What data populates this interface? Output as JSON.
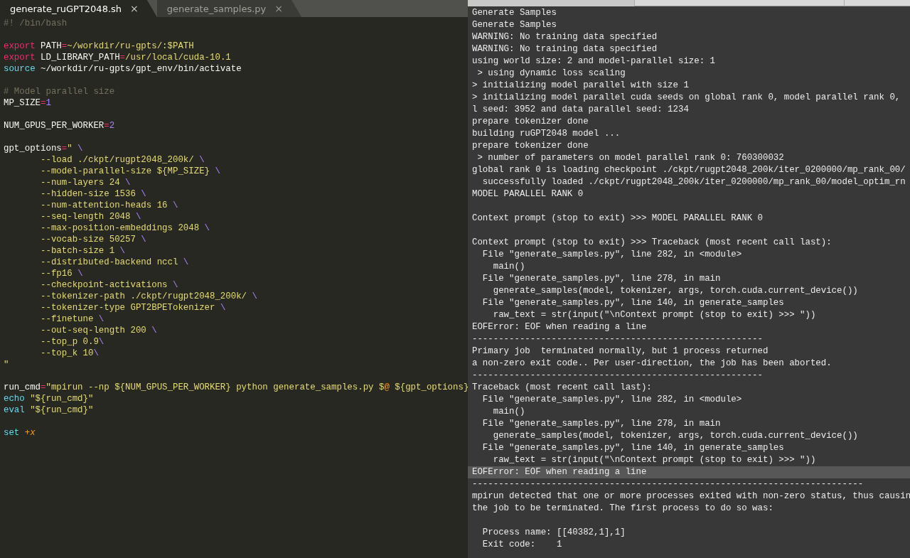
{
  "editor": {
    "tabs": [
      {
        "label": "generate_ruGPT2048.sh",
        "close": "×",
        "selected": true
      },
      {
        "label": "generate_samples.py",
        "close": "×",
        "selected": false
      }
    ],
    "lines": [
      {
        "kind": "code",
        "tokens": [
          {
            "text": "#! /bin/bash",
            "kind": "comment"
          }
        ]
      },
      {
        "kind": "blank"
      },
      {
        "kind": "code",
        "tokens": [
          {
            "text": "export",
            "kind": "keyword"
          },
          {
            "text": " PATH",
            "kind": "plain"
          },
          {
            "text": "=",
            "kind": "operator"
          },
          {
            "text": "~/workdir/ru-gpts/:$PATH",
            "kind": "string"
          }
        ]
      },
      {
        "kind": "code",
        "tokens": [
          {
            "text": "export",
            "kind": "keyword"
          },
          {
            "text": " LD_LIBRARY_PATH",
            "kind": "plain"
          },
          {
            "text": "=",
            "kind": "operator"
          },
          {
            "text": "/usr/local/cuda-10.1",
            "kind": "string"
          }
        ]
      },
      {
        "kind": "code",
        "tokens": [
          {
            "text": "source",
            "kind": "builtin"
          },
          {
            "text": " ~/workdir/ru-gpts/gpt_env/bin/activate",
            "kind": "plain"
          }
        ]
      },
      {
        "kind": "blank"
      },
      {
        "kind": "code",
        "tokens": [
          {
            "text": "# Model parallel size",
            "kind": "comment"
          }
        ]
      },
      {
        "kind": "code",
        "tokens": [
          {
            "text": "MP_SIZE",
            "kind": "plain"
          },
          {
            "text": "=",
            "kind": "operator"
          },
          {
            "text": "1",
            "kind": "number"
          }
        ]
      },
      {
        "kind": "blank"
      },
      {
        "kind": "code",
        "tokens": [
          {
            "text": "NUM_GPUS_PER_WORKER",
            "kind": "plain"
          },
          {
            "text": "=",
            "kind": "operator"
          },
          {
            "text": "2",
            "kind": "number"
          }
        ]
      },
      {
        "kind": "blank"
      },
      {
        "kind": "code",
        "tokens": [
          {
            "text": "gpt_options",
            "kind": "plain"
          },
          {
            "text": "=",
            "kind": "operator"
          },
          {
            "text": "\" ",
            "kind": "string"
          },
          {
            "text": "\\",
            "kind": "escape"
          }
        ]
      },
      {
        "kind": "code",
        "tokens": [
          {
            "text": "\t--load ./ckpt/rugpt2048_200k/ ",
            "kind": "string"
          },
          {
            "text": "\\",
            "kind": "escape"
          }
        ]
      },
      {
        "kind": "code",
        "tokens": [
          {
            "text": "\t--model-parallel-size ${MP_SIZE} ",
            "kind": "string"
          },
          {
            "text": "\\",
            "kind": "escape"
          }
        ]
      },
      {
        "kind": "code",
        "tokens": [
          {
            "text": "\t--num-layers 24 ",
            "kind": "string"
          },
          {
            "text": "\\",
            "kind": "escape"
          }
        ]
      },
      {
        "kind": "code",
        "tokens": [
          {
            "text": "\t--hidden-size 1536 ",
            "kind": "string"
          },
          {
            "text": "\\",
            "kind": "escape"
          }
        ]
      },
      {
        "kind": "code",
        "tokens": [
          {
            "text": "\t--num-attention-heads 16 ",
            "kind": "string"
          },
          {
            "text": "\\",
            "kind": "escape"
          }
        ]
      },
      {
        "kind": "code",
        "tokens": [
          {
            "text": "\t--seq-length 2048 ",
            "kind": "string"
          },
          {
            "text": "\\",
            "kind": "escape"
          }
        ]
      },
      {
        "kind": "code",
        "tokens": [
          {
            "text": "\t--max-position-embeddings 2048 ",
            "kind": "string"
          },
          {
            "text": "\\",
            "kind": "escape"
          }
        ]
      },
      {
        "kind": "code",
        "tokens": [
          {
            "text": "\t--vocab-size 50257 ",
            "kind": "string"
          },
          {
            "text": "\\",
            "kind": "escape"
          }
        ]
      },
      {
        "kind": "code",
        "tokens": [
          {
            "text": "\t--batch-size 1 ",
            "kind": "string"
          },
          {
            "text": "\\",
            "kind": "escape"
          }
        ]
      },
      {
        "kind": "code",
        "tokens": [
          {
            "text": "\t--distributed-backend nccl ",
            "kind": "string"
          },
          {
            "text": "\\",
            "kind": "escape"
          }
        ]
      },
      {
        "kind": "code",
        "tokens": [
          {
            "text": "\t--fp16 ",
            "kind": "string"
          },
          {
            "text": "\\",
            "kind": "escape"
          }
        ]
      },
      {
        "kind": "code",
        "tokens": [
          {
            "text": "\t--checkpoint-activations ",
            "kind": "string"
          },
          {
            "text": "\\",
            "kind": "escape"
          }
        ]
      },
      {
        "kind": "code",
        "tokens": [
          {
            "text": "\t--tokenizer-path ./ckpt/rugpt2048_200k/ ",
            "kind": "string"
          },
          {
            "text": "\\",
            "kind": "escape"
          }
        ]
      },
      {
        "kind": "code",
        "tokens": [
          {
            "text": "\t--tokenizer-type GPT2BPETokenizer ",
            "kind": "string"
          },
          {
            "text": "\\",
            "kind": "escape"
          }
        ]
      },
      {
        "kind": "code",
        "tokens": [
          {
            "text": "\t--finetune ",
            "kind": "string"
          },
          {
            "text": "\\",
            "kind": "escape"
          }
        ]
      },
      {
        "kind": "code",
        "tokens": [
          {
            "text": "\t--out-seq-length 200 ",
            "kind": "string"
          },
          {
            "text": "\\",
            "kind": "escape"
          }
        ]
      },
      {
        "kind": "code",
        "tokens": [
          {
            "text": "\t--top_p 0.9",
            "kind": "string"
          },
          {
            "text": "\\",
            "kind": "escape"
          }
        ]
      },
      {
        "kind": "code",
        "tokens": [
          {
            "text": "\t--top_k 10",
            "kind": "string"
          },
          {
            "text": "\\",
            "kind": "escape"
          }
        ]
      },
      {
        "kind": "code",
        "tokens": [
          {
            "text": "\"",
            "kind": "string"
          }
        ]
      },
      {
        "kind": "blank"
      },
      {
        "kind": "code",
        "tokens": [
          {
            "text": "run_cmd",
            "kind": "plain"
          },
          {
            "text": "=",
            "kind": "operator"
          },
          {
            "text": "\"mpirun --np ${NUM_GPUS_PER_WORKER} python generate_samples.py $",
            "kind": "string"
          },
          {
            "text": "@",
            "kind": "special"
          },
          {
            "text": " ${gpt_options}",
            "kind": "string"
          }
        ]
      },
      {
        "kind": "code",
        "tokens": [
          {
            "text": "echo",
            "kind": "builtin"
          },
          {
            "text": " \"${run_cmd}\"",
            "kind": "string"
          }
        ]
      },
      {
        "kind": "code",
        "tokens": [
          {
            "text": "eval",
            "kind": "builtin"
          },
          {
            "text": " \"${run_cmd}\"",
            "kind": "string"
          }
        ]
      },
      {
        "kind": "blank"
      },
      {
        "kind": "code",
        "tokens": [
          {
            "text": "set ",
            "kind": "builtin"
          },
          {
            "text": "+x",
            "kind": "special-italic"
          }
        ]
      }
    ]
  },
  "terminal": {
    "lines": [
      {
        "text": "Generate Samples",
        "highlighted": false
      },
      {
        "text": "Generate Samples",
        "highlighted": false
      },
      {
        "text": "WARNING: No training data specified",
        "highlighted": false
      },
      {
        "text": "WARNING: No training data specified",
        "highlighted": false
      },
      {
        "text": "using world size: 2 and model-parallel size: 1",
        "highlighted": false
      },
      {
        "text": " > using dynamic loss scaling",
        "highlighted": false
      },
      {
        "text": "> initializing model parallel with size 1",
        "highlighted": false
      },
      {
        "text": "> initializing model parallel cuda seeds on global rank 0, model parallel rank 0, ",
        "highlighted": false
      },
      {
        "text": "l seed: 3952 and data parallel seed: 1234",
        "highlighted": false
      },
      {
        "text": "prepare tokenizer done",
        "highlighted": false
      },
      {
        "text": "building ruGPT2048 model ...",
        "highlighted": false
      },
      {
        "text": "prepare tokenizer done",
        "highlighted": false
      },
      {
        "text": " > number of parameters on model parallel rank 0: 760300032",
        "highlighted": false
      },
      {
        "text": "global rank 0 is loading checkpoint ./ckpt/rugpt2048_200k/iter_0200000/mp_rank_00/",
        "highlighted": false
      },
      {
        "text": "  successfully loaded ./ckpt/rugpt2048_200k/iter_0200000/mp_rank_00/model_optim_rn",
        "highlighted": false
      },
      {
        "text": "MODEL PARALLEL RANK 0",
        "highlighted": false,
        "blank_after": true
      },
      {
        "text": "Context prompt (stop to exit) >>> MODEL PARALLEL RANK 0",
        "highlighted": false,
        "blank_after": true
      },
      {
        "text": "Context prompt (stop to exit) >>> Traceback (most recent call last):",
        "highlighted": false
      },
      {
        "text": "  File \"generate_samples.py\", line 282, in <module>",
        "highlighted": false
      },
      {
        "text": "    main()",
        "highlighted": false
      },
      {
        "text": "  File \"generate_samples.py\", line 278, in main",
        "highlighted": false
      },
      {
        "text": "    generate_samples(model, tokenizer, args, torch.cuda.current_device())",
        "highlighted": false
      },
      {
        "text": "  File \"generate_samples.py\", line 140, in generate_samples",
        "highlighted": false
      },
      {
        "text": "    raw_text = str(input(\"\\nContext prompt (stop to exit) >>> \"))",
        "highlighted": false
      },
      {
        "text": "EOFError: EOF when reading a line",
        "highlighted": false
      },
      {
        "text": "-------------------------------------------------------",
        "highlighted": false
      },
      {
        "text": "Primary job  terminated normally, but 1 process returned",
        "highlighted": false
      },
      {
        "text": "a non-zero exit code.. Per user-direction, the job has been aborted.",
        "highlighted": false
      },
      {
        "text": "-------------------------------------------------------",
        "highlighted": false
      },
      {
        "text": "Traceback (most recent call last):",
        "highlighted": false
      },
      {
        "text": "  File \"generate_samples.py\", line 282, in <module>",
        "highlighted": false
      },
      {
        "text": "    main()",
        "highlighted": false
      },
      {
        "text": "  File \"generate_samples.py\", line 278, in main",
        "highlighted": false
      },
      {
        "text": "    generate_samples(model, tokenizer, args, torch.cuda.current_device())",
        "highlighted": false
      },
      {
        "text": "  File \"generate_samples.py\", line 140, in generate_samples",
        "highlighted": false
      },
      {
        "text": "    raw_text = str(input(\"\\nContext prompt (stop to exit) >>> \"))",
        "highlighted": false
      },
      {
        "text": "EOFError: EOF when reading a line",
        "highlighted": true
      },
      {
        "text": "--------------------------------------------------------------------------",
        "highlighted": false
      },
      {
        "text": "mpirun detected that one or more processes exited with non-zero status, thus causin",
        "highlighted": false
      },
      {
        "text": "the job to be terminated. The first process to do so was:",
        "highlighted": false,
        "blank_after": true
      },
      {
        "text": "  Process name: [[40382,1],1]",
        "highlighted": false
      },
      {
        "text": "  Exit code:    1",
        "highlighted": false
      }
    ]
  }
}
